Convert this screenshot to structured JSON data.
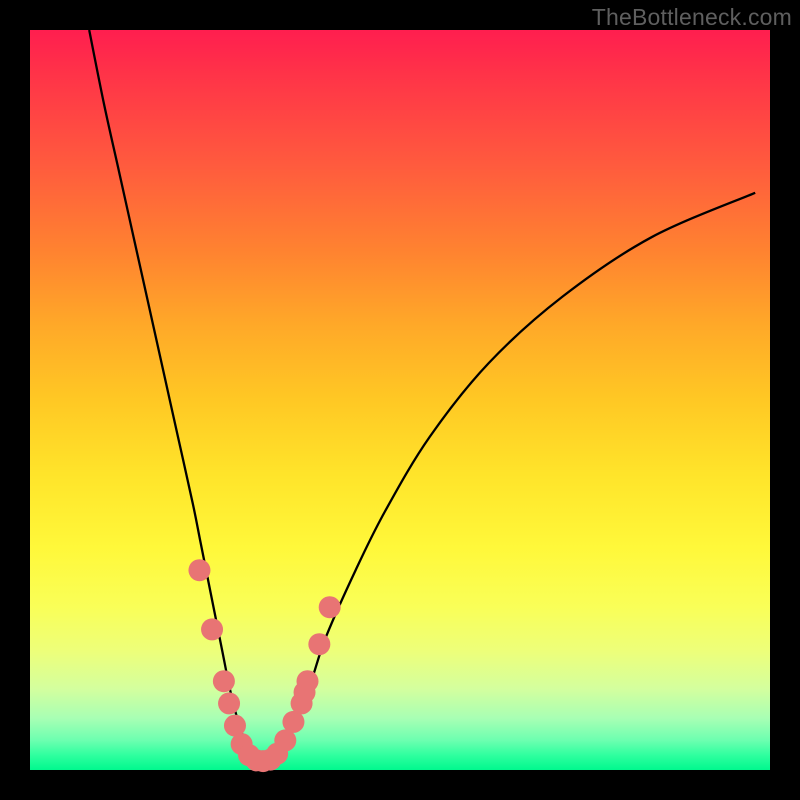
{
  "watermark": "TheBottleneck.com",
  "chart_data": {
    "type": "line",
    "title": "",
    "xlabel": "",
    "ylabel": "",
    "xlim": [
      0,
      100
    ],
    "ylim": [
      0,
      100
    ],
    "grid": false,
    "series": [
      {
        "name": "curve",
        "x": [
          8,
          10,
          12,
          14,
          16,
          18,
          20,
          22,
          23,
          24,
          25,
          26,
          27,
          28,
          29,
          30,
          31,
          32,
          33,
          34,
          36,
          38,
          40,
          44,
          48,
          54,
          62,
          72,
          84,
          98
        ],
        "values": [
          100,
          90,
          81,
          72,
          63,
          54,
          45,
          36,
          31,
          26,
          21,
          16,
          11,
          7,
          4,
          2,
          1,
          1,
          2,
          3,
          7,
          12,
          18,
          27,
          35,
          45,
          55,
          64,
          72,
          78
        ]
      }
    ],
    "highlight_points": {
      "name": "dots",
      "x": [
        22.9,
        24.6,
        26.2,
        26.9,
        27.7,
        28.6,
        29.6,
        30.6,
        31.5,
        32.5,
        33.4,
        34.5,
        35.6,
        36.7,
        37.1,
        37.5,
        39.1,
        40.5
      ],
      "values": [
        27,
        19,
        12,
        9,
        6,
        3.5,
        2,
        1.3,
        1.2,
        1.4,
        2.2,
        4,
        6.5,
        9,
        10.5,
        12,
        17,
        22
      ]
    }
  }
}
